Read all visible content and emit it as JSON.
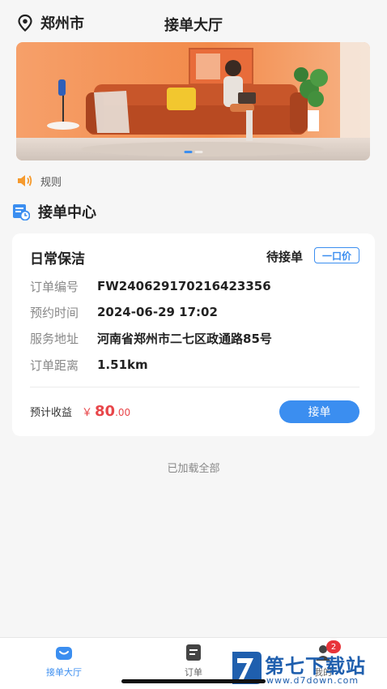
{
  "header": {
    "city": "郑州市",
    "title": "接单大厅"
  },
  "banner": {
    "slides": 2,
    "active_slide": 1
  },
  "notice": {
    "label": "规则"
  },
  "section": {
    "title": "接单中心"
  },
  "order": {
    "service": "日常保洁",
    "status": "待接单",
    "price_type": "一口价",
    "fields": [
      {
        "label": "订单编号",
        "value": "FW240629170216423356"
      },
      {
        "label": "预约时间",
        "value": "2024-06-29 17:02"
      },
      {
        "label": "服务地址",
        "value": "河南省郑州市二七区政通路85号"
      },
      {
        "label": "订单距离",
        "value": "1.51km"
      }
    ],
    "earnings_label": "预计收益",
    "currency": "￥",
    "earnings_int": "80",
    "earnings_dec": ".00",
    "accept_label": "接单"
  },
  "list_footer": "已加载全部",
  "tabbar": {
    "items": [
      {
        "label": "接单大厅",
        "icon": "hall-icon",
        "active": true
      },
      {
        "label": "订单",
        "icon": "order-list-icon",
        "active": false
      },
      {
        "label": "我的",
        "icon": "profile-icon",
        "active": false,
        "badge": "2"
      }
    ]
  },
  "watermark": {
    "name": "第七下载站",
    "url": "www.d7down.com"
  },
  "colors": {
    "accent": "#3b8ef0",
    "price": "#e8464a",
    "badge": "#e8343a",
    "banner_wall": "#f28a4a"
  }
}
